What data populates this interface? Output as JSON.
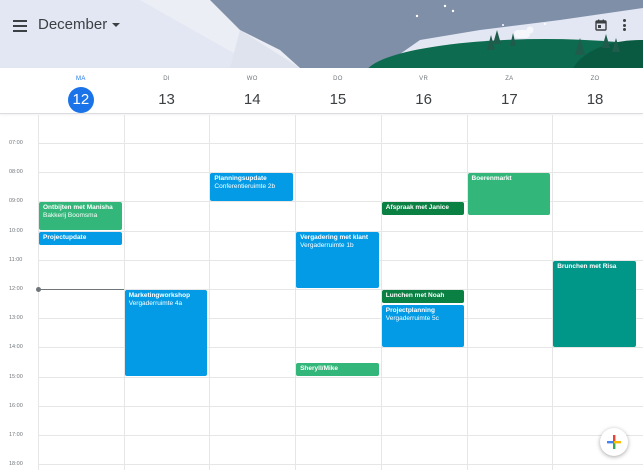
{
  "header": {
    "month": "December",
    "colors": {
      "sky": "#e3e7f3",
      "mountain": "#7f8fa8",
      "hill": "#0d6b4f",
      "tree": "#1f5c4b"
    }
  },
  "days": [
    {
      "dow": "MA",
      "date": "12",
      "today": true
    },
    {
      "dow": "DI",
      "date": "13",
      "today": false
    },
    {
      "dow": "WO",
      "date": "14",
      "today": false
    },
    {
      "dow": "DO",
      "date": "15",
      "today": false
    },
    {
      "dow": "VR",
      "date": "16",
      "today": false
    },
    {
      "dow": "ZA",
      "date": "17",
      "today": false
    },
    {
      "dow": "ZO",
      "date": "18",
      "today": false
    }
  ],
  "hours": [
    "07:00",
    "08:00",
    "09:00",
    "10:00",
    "11:00",
    "12:00",
    "13:00",
    "14:00",
    "15:00",
    "16:00",
    "17:00",
    "18:00"
  ],
  "events": [
    {
      "day": 0,
      "start": 9.0,
      "end": 10.0,
      "title": "Ontbijten met Manisha",
      "location": "Bakkerij Boomsma",
      "color": "#33b679"
    },
    {
      "day": 0,
      "start": 10.0,
      "end": 10.5,
      "title": "Projectupdate",
      "location": "",
      "color": "#039be5"
    },
    {
      "day": 1,
      "start": 12.0,
      "end": 15.0,
      "title": "Marketingworkshop",
      "location": "Vergaderruimte 4a",
      "color": "#039be5"
    },
    {
      "day": 2,
      "start": 8.0,
      "end": 9.0,
      "title": "Planningsupdate",
      "location": "Conferentieruimte 2b",
      "color": "#039be5"
    },
    {
      "day": 3,
      "start": 10.0,
      "end": 12.0,
      "title": "Vergadering met klant",
      "location": "Vergaderruimte 1b",
      "color": "#039be5"
    },
    {
      "day": 3,
      "start": 14.5,
      "end": 15.0,
      "title": "Sheryll/Mike",
      "location": "",
      "color": "#33b679"
    },
    {
      "day": 4,
      "start": 9.0,
      "end": 9.5,
      "title": "Afspraak met Janice",
      "location": "",
      "color": "#0b8043"
    },
    {
      "day": 4,
      "start": 12.0,
      "end": 12.5,
      "title": "Lunchen met Noah",
      "location": "",
      "color": "#0b8043"
    },
    {
      "day": 4,
      "start": 12.5,
      "end": 14.0,
      "title": "Projectplanning",
      "location": "Vergaderruimte 5c",
      "color": "#039be5"
    },
    {
      "day": 5,
      "start": 8.0,
      "end": 9.5,
      "title": "Boerenmarkt",
      "location": "",
      "color": "#33b679"
    },
    {
      "day": 6,
      "start": 11.0,
      "end": 14.0,
      "title": "Brunchen met Risa",
      "location": "",
      "color": "#009688"
    }
  ],
  "now": {
    "day": 0,
    "time": 12.0
  },
  "icons": {
    "menu": "menu-icon",
    "dropdown": "caret-down-icon",
    "today": "calendar-today-icon",
    "more": "more-vert-icon",
    "fab": "plus-icon"
  }
}
